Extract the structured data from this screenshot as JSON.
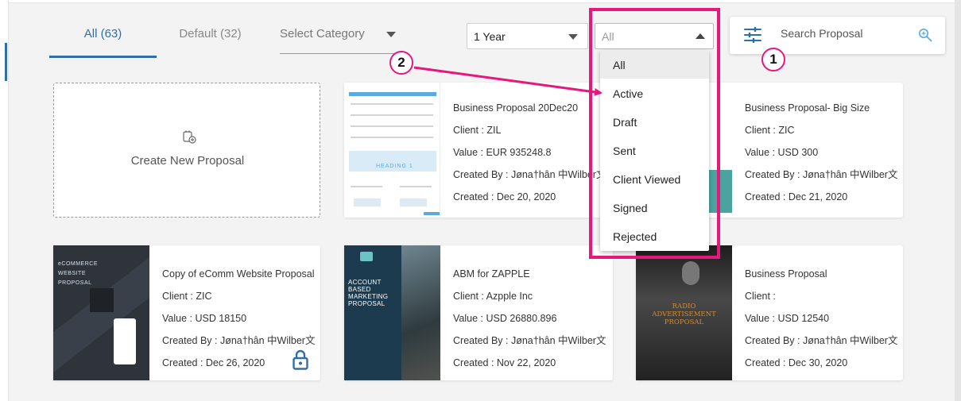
{
  "tabs": [
    {
      "label": "All (63)",
      "active": true
    },
    {
      "label": "Default (32)",
      "active": false
    }
  ],
  "category_select": {
    "placeholder": "Select Category"
  },
  "filters": {
    "period": {
      "value": "1 Year"
    },
    "status": {
      "value": "All",
      "options": [
        "All",
        "Active",
        "Draft",
        "Sent",
        "Client Viewed",
        "Signed",
        "Rejected"
      ]
    }
  },
  "search": {
    "placeholder": "Search Proposal"
  },
  "annotations": {
    "badge_1": "1",
    "badge_2": "2",
    "color": "#e6177d"
  },
  "create": {
    "label": "Create New Proposal"
  },
  "cards": [
    {
      "title": "Business Proposal 20Dec20",
      "client": "Client : ZIL",
      "value": "Value : EUR 935248.8",
      "created_by": "Created By : Jøna†hân 中Wilber文",
      "created": "Created : Dec 20, 2020",
      "thumb_text": "HEADING 1"
    },
    {
      "title": "Business Proposal- Big Size",
      "client": "Client : ZIC",
      "value": "Value : USD 300",
      "created_by": "Created By : Jøna†hân 中Wilber文",
      "created": "Created : Dec 21, 2020"
    },
    {
      "title": "Copy of eComm Website Proposal",
      "client": "Client : ZIC",
      "value": "Value : USD 18150",
      "created_by": "Created By : Jøna†hân 中Wilber文",
      "created": "Created : Dec 26, 2020",
      "thumb_lines": [
        "eCOMMERCE",
        "WEBSITE",
        "PROPOSAL"
      ],
      "locked": true
    },
    {
      "title": "ABM for ZAPPLE",
      "client": "Client : Azpple Inc",
      "value": "Value : USD 26880.896",
      "created_by": "Created By : Jøna†hân 中Wilber文",
      "created": "Created : Nov 22, 2020",
      "thumb_lines": [
        "ACCOUNT",
        "BASED",
        "MARKETING",
        "PROPOSAL"
      ]
    },
    {
      "title": "Business Proposal",
      "client": "Client :",
      "value": "Value : USD 12540",
      "created_by": "Created By : Jøna†hân 中Wilber文",
      "created": "Created : Dec 30, 2020",
      "thumb_lines": [
        "RADIO",
        "ADVERTISEMENT",
        "PROPOSAL"
      ]
    }
  ],
  "colors": {
    "accent": "#2f6fa8",
    "highlight": "#e6177d",
    "card_bg": "#ffffff",
    "page_bg": "#f3f3f3"
  }
}
